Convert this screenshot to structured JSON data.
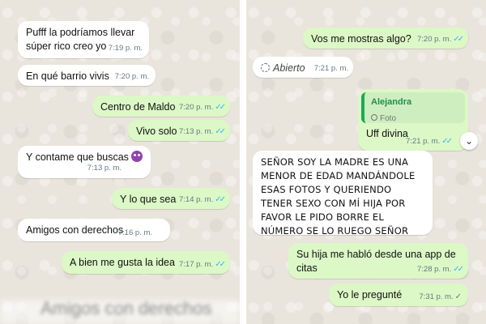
{
  "left_chat": {
    "messages": [
      {
        "text": "Pufff la podríamos llevar súper rico creo yo",
        "time": "7:19 p. m.",
        "direction": "in"
      },
      {
        "text": "En qué barrio vivis",
        "time": "7:20 p. m.",
        "direction": "in"
      },
      {
        "text": "Centro de Maldo",
        "time": "7:20 p. m.",
        "direction": "out",
        "status": "read"
      },
      {
        "text": "Vivo solo",
        "time": "7:13 p. m.",
        "direction": "out",
        "status": "read"
      },
      {
        "text": "Y contame que buscas",
        "time": "7:13 p. m.",
        "direction": "in",
        "emoji": "smiling-devil-emoji"
      },
      {
        "text": "Y lo que sea",
        "time": "7:14 p. m.",
        "direction": "out",
        "status": "read"
      },
      {
        "text": "Amigos con derechos",
        "time": "7:16 p. m.",
        "direction": "in"
      },
      {
        "text": "A bien me gusta la idea",
        "time": "7:17 p. m.",
        "direction": "out",
        "status": "read"
      }
    ],
    "blurred_text": "Amigos con derechos"
  },
  "right_chat": {
    "messages": [
      {
        "text": "Vos me mostras algo?",
        "time": "7:20 p. m.",
        "direction": "out",
        "status": "read"
      },
      {
        "text": "Abierto",
        "time": "7:21 p. m.",
        "direction": "in",
        "kind": "view-once-opened"
      },
      {
        "quote_name": "Alejandra",
        "quote_sub": "Foto",
        "text": "Uff divina",
        "time": "7:21 p. m.",
        "direction": "out",
        "status": "read"
      },
      {
        "text": "SEÑOR SOY LA MADRE ES UNA MENOR DE EDAD MANDÁNDOLE ESAS FOTOS Y QUERIENDO TENER SEXO CON MÍ HIJA POR FAVOR LE PIDO BORRE EL NÚMERO SE LO RUEGO SEÑOR",
        "direction": "in"
      },
      {
        "text": "Su hija me habló desde una app de citas",
        "time": "7:28 p. m.",
        "direction": "out",
        "status": "read"
      },
      {
        "text": "Yo le pregunté",
        "time": "7:31 p. m.",
        "direction": "out",
        "status": "sent"
      }
    ]
  },
  "colors": {
    "incoming": "#ffffff",
    "outgoing": "#dcf8c6",
    "read_tick": "#34b7f1",
    "quote_accent": "#1da85a",
    "wallpaper": "#e9e4dc"
  },
  "icons": [
    "double-check-icon",
    "single-check-icon",
    "view-once-icon",
    "photo-icon",
    "chevron-down-icon",
    "smiling-devil-emoji"
  ]
}
